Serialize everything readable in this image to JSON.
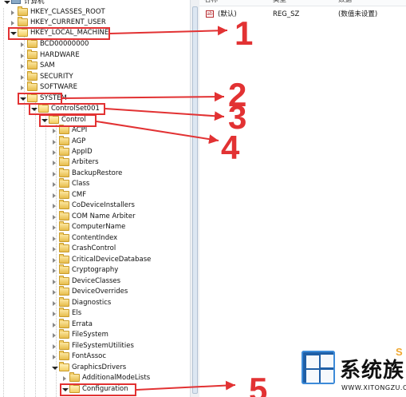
{
  "tree": {
    "root_label": "计算机",
    "nodes": [
      {
        "label": "HKEY_CLASSES_ROOT"
      },
      {
        "label": "HKEY_CURRENT_USER"
      },
      {
        "label": "HKEY_LOCAL_MACHINE"
      },
      {
        "label": "BCD00000000"
      },
      {
        "label": "HARDWARE"
      },
      {
        "label": "SAM"
      },
      {
        "label": "SECURITY"
      },
      {
        "label": "SOFTWARE"
      },
      {
        "label": "SYSTEM"
      },
      {
        "label": "ControlSet001"
      },
      {
        "label": "Control"
      },
      {
        "label": "ACPI"
      },
      {
        "label": "AGP"
      },
      {
        "label": "AppID"
      },
      {
        "label": "Arbiters"
      },
      {
        "label": "BackupRestore"
      },
      {
        "label": "Class"
      },
      {
        "label": "CMF"
      },
      {
        "label": "CoDeviceInstallers"
      },
      {
        "label": "COM Name Arbiter"
      },
      {
        "label": "ComputerName"
      },
      {
        "label": "ContentIndex"
      },
      {
        "label": "CrashControl"
      },
      {
        "label": "CriticalDeviceDatabase"
      },
      {
        "label": "Cryptography"
      },
      {
        "label": "DeviceClasses"
      },
      {
        "label": "DeviceOverrides"
      },
      {
        "label": "Diagnostics"
      },
      {
        "label": "Els"
      },
      {
        "label": "Errata"
      },
      {
        "label": "FileSystem"
      },
      {
        "label": "FileSystemUtilities"
      },
      {
        "label": "FontAssoc"
      },
      {
        "label": "GraphicsDrivers"
      },
      {
        "label": "AdditionalModeLists"
      },
      {
        "label": "Configuration"
      }
    ]
  },
  "values": {
    "headers": {
      "name": "名称",
      "type": "类型",
      "data": "数据"
    },
    "rows": [
      {
        "name": "(默认)",
        "type": "REG_SZ",
        "data": "(数值未设置)"
      }
    ]
  },
  "annotations": {
    "callouts": [
      "1",
      "2",
      "3",
      "4",
      "5"
    ],
    "accent_color": "#e23233"
  },
  "watermark": {
    "title": "系统族",
    "url": "WWW.XITONGZU.COM",
    "badge": "S"
  }
}
